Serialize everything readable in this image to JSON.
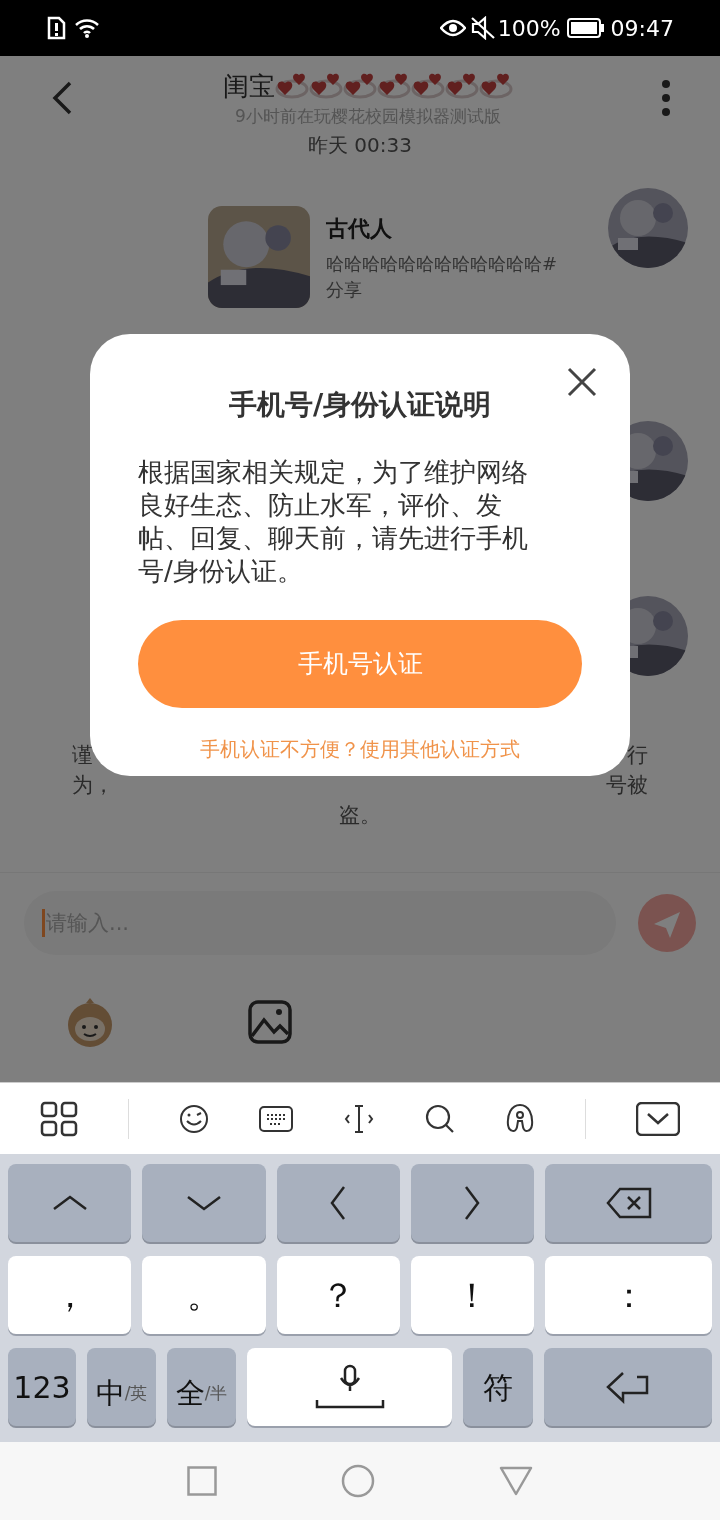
{
  "status_bar": {
    "battery": "100%",
    "time": "09:47"
  },
  "header": {
    "title": "闺宝",
    "subtitle": "9小时前在玩樱花校园模拟器测试版"
  },
  "chat": {
    "timestamp": "昨天 00:33",
    "messages": [
      {
        "kind": "share",
        "title": "古代人",
        "text": "哈哈哈哈哈哈哈哈哈哈哈哈#分享"
      },
      {
        "kind": "covered"
      },
      {
        "kind": "covered"
      }
    ],
    "notice_fragments": [
      [
        "谨",
        "行"
      ],
      [
        "为，",
        "号被"
      ],
      [
        "盗。"
      ]
    ]
  },
  "input": {
    "placeholder": "请输入..."
  },
  "dialog": {
    "title": "手机号/身份认证说明",
    "body": "根据国家相关规定，为了维护网络良好生态、防止水军，评价、发帖、回复、聊天前，请先进行手机号/身份认证。",
    "primary_button": "手机号认证",
    "alt_link": "手机认证不方便？使用其他认证方式"
  },
  "keyboard": {
    "punctuation": [
      "，",
      "。",
      "？",
      "！",
      "："
    ],
    "bottom_keys": [
      {
        "kind": "text",
        "label": "123"
      },
      {
        "kind": "toggle",
        "label": "中",
        "sub": "/英"
      },
      {
        "kind": "toggle",
        "label": "全",
        "sub": "/半"
      },
      {
        "kind": "space"
      },
      {
        "kind": "text",
        "label": "符"
      },
      {
        "kind": "enter"
      }
    ]
  }
}
